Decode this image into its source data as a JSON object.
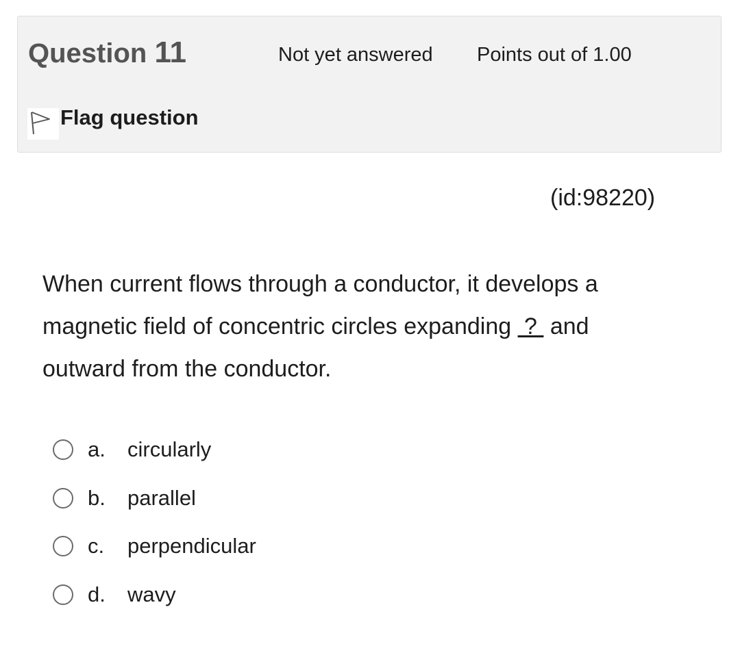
{
  "info": {
    "title_prefix": "Question",
    "number": "11",
    "state": "Not yet answered",
    "grade": "Points out of 1.00",
    "flag_label": "Flag question"
  },
  "question": {
    "id_text": "(id:98220)",
    "text_before": "When current flows through a conductor, it develops a magnetic field of concentric circles expanding ",
    "blank": " ? ",
    "text_after": " and outward from the conductor."
  },
  "answers": [
    {
      "letter": "a.",
      "text": "circularly"
    },
    {
      "letter": "b.",
      "text": "parallel"
    },
    {
      "letter": "c.",
      "text": "perpendicular"
    },
    {
      "letter": "d.",
      "text": "wavy"
    }
  ],
  "colors": {
    "info_bg": "#f2f2f2",
    "title": "#545454",
    "text": "#1d1d1d",
    "radio_border": "#6b6b6b"
  },
  "icons": {
    "flag": "flag-icon"
  }
}
